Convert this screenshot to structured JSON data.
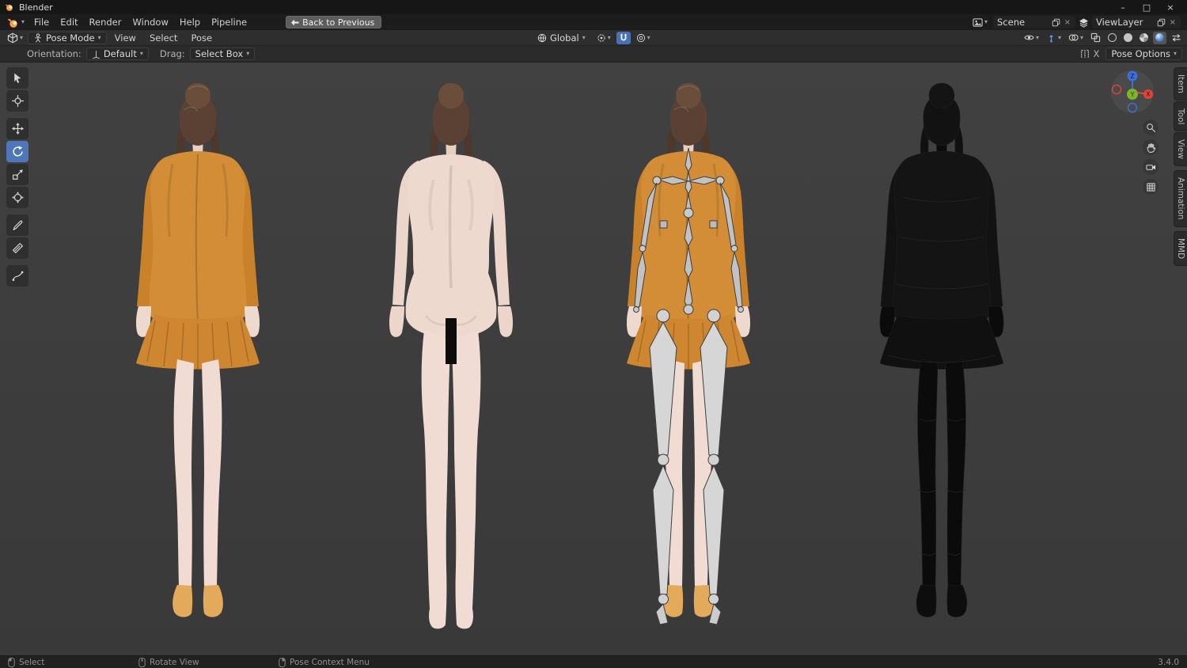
{
  "titlebar": {
    "app_name": "Blender"
  },
  "window_controls": {
    "minimize": "–",
    "maximize": "□",
    "close": "×"
  },
  "menubar": {
    "menus": [
      "File",
      "Edit",
      "Render",
      "Window",
      "Help",
      "Pipeline"
    ],
    "back_button": "Back to Previous",
    "scene_name": "Scene",
    "view_layer_name": "ViewLayer",
    "unlink": "×"
  },
  "viewport_header": {
    "mode": "Pose Mode",
    "menus": [
      "View",
      "Select",
      "Pose"
    ],
    "orientation": "Global"
  },
  "tool_settings": {
    "orientation_label": "Orientation:",
    "orientation_value": "Default",
    "drag_label": "Drag:",
    "drag_value": "Select Box",
    "x_label": "X",
    "pose_options_label": "Pose Options"
  },
  "sidebar_tabs": [
    "Item",
    "Tool",
    "View",
    "Animation",
    "MMD"
  ],
  "axis_gizmo": {
    "z": "Z",
    "y": "Y",
    "x": "X"
  },
  "statusbar": {
    "select": "Select",
    "rotate_view": "Rotate View",
    "pose_context_menu": "Pose Context Menu",
    "version": "3.4.0"
  },
  "icons": {
    "chevron": "▾"
  },
  "colors": {
    "accent_blue": "#4772b3",
    "jacket_orange": "#d28d36",
    "skin": "#eed9cf",
    "hair_brown": "#5a4133",
    "axis_x_red": "#e0453c",
    "axis_y_green": "#7db32e",
    "axis_z_blue": "#3e6fd9"
  }
}
